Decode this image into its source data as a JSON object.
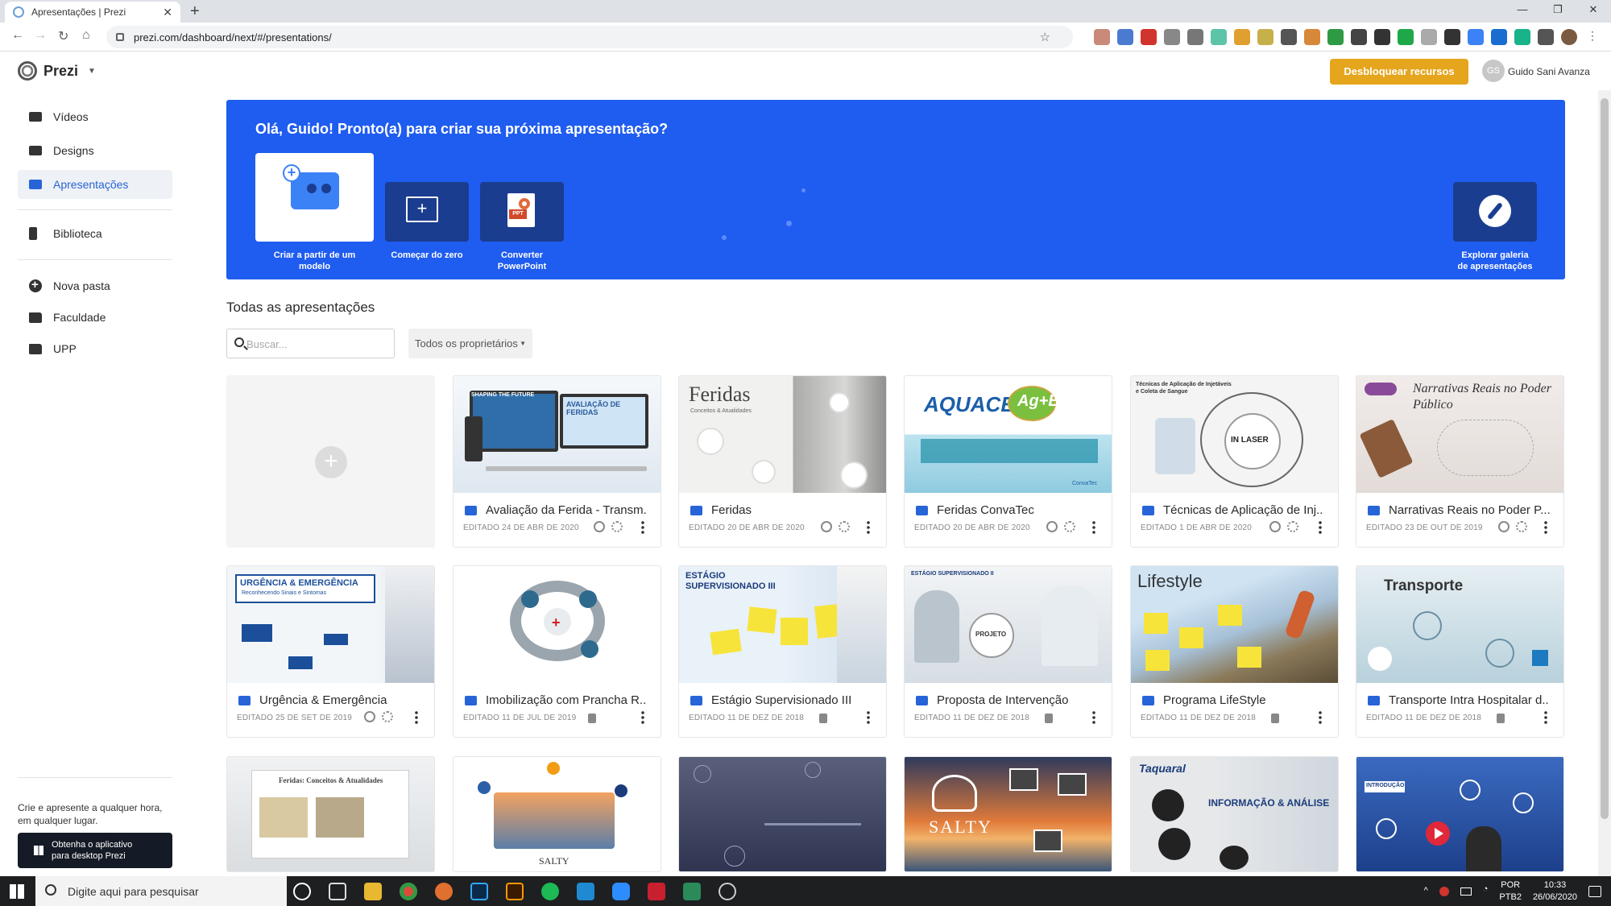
{
  "browser": {
    "tab_title": "Apresentações | Prezi",
    "url": "prezi.com/dashboard/next/#/presentations/"
  },
  "header": {
    "logo_text": "Prezi",
    "unlock_button": "Desbloquear recursos",
    "avatar_initials": "GS",
    "user_name": "Guido Sani Avanza"
  },
  "sidebar": {
    "items": [
      {
        "label": "Vídeos"
      },
      {
        "label": "Designs"
      },
      {
        "label": "Apresentações"
      },
      {
        "label": "Biblioteca"
      },
      {
        "label": "Nova pasta"
      },
      {
        "label": "Faculdade"
      },
      {
        "label": "UPP"
      }
    ],
    "promo_text": "Crie e apresente a qualquer hora, em qualquer lugar.",
    "get_app_line1": "Obtenha o aplicativo",
    "get_app_line2": "para desktop Prezi"
  },
  "hero": {
    "greeting": "Olá, Guido! Pronto(a) para criar sua próxima apresentação?",
    "card_template_l1": "Criar a partir de um",
    "card_template_l2": "modelo",
    "card_blank": "Começar do zero",
    "card_ppt_l1": "Converter",
    "card_ppt_l2": "PowerPoint",
    "card_gallery_l1": "Explorar galeria",
    "card_gallery_l2": "de apresentações"
  },
  "section": {
    "title": "Todas as apresentações",
    "search_placeholder": "Buscar...",
    "owners_filter": "Todos os proprietários"
  },
  "presentations": [
    {
      "title": "Avaliação da Ferida - Transm...",
      "edited": "EDITADO 24 DE ABR DE 2020",
      "status": "public"
    },
    {
      "title": "Feridas",
      "edited": "EDITADO 20 DE ABR DE 2020",
      "status": "public"
    },
    {
      "title": "Feridas ConvaTec",
      "edited": "EDITADO 20 DE ABR DE 2020",
      "status": "public"
    },
    {
      "title": "Técnicas de Aplicação de Inj...",
      "edited": "EDITADO 1 DE ABR DE 2020",
      "status": "public"
    },
    {
      "title": "Narrativas Reais no Poder P...",
      "edited": "EDITADO 23 DE OUT DE 2019",
      "status": "public"
    },
    {
      "title": "Urgência & Emergência",
      "edited": "EDITADO 25 DE SET DE 2019",
      "status": "public"
    },
    {
      "title": "Imobilização com Prancha R...",
      "edited": "EDITADO 11 DE JUL DE 2019",
      "status": "private"
    },
    {
      "title": "Estágio Supervisionado III",
      "edited": "EDITADO 11 DE DEZ DE 2018",
      "status": "private"
    },
    {
      "title": "Proposta de Intervenção",
      "edited": "EDITADO 11 DE DEZ DE 2018",
      "status": "private"
    },
    {
      "title": "Programa LifeStyle",
      "edited": "EDITADO 11 DE DEZ DE 2018",
      "status": "private"
    },
    {
      "title": "Transporte Intra Hospitalar d...",
      "edited": "EDITADO 11 DE DEZ DE 2018",
      "status": "private"
    }
  ],
  "thumb_texts": {
    "feridas_title": "Feridas",
    "feridas_sub": "Conceitos & Atualidades",
    "aquacel": "AQUACEL",
    "aquacel_ag": "Ag+Extra",
    "convatec": "ConvaTec",
    "tecnicas": "Técnicas de Aplicação de Injetáveis e Coleta de Sangue",
    "inlaser": "IN LASER",
    "narrativas": "Narrativas Reais no Poder Público",
    "urgencia": "URGÊNCIA & EMERGÊNCIA",
    "urgencia_sub": "Reconhecendo Sinais e Sintomas",
    "estagio3": "ESTÁGIO SUPERVISIONADO III",
    "estagio2": "ESTÁGIO SUPERVISIONADO II",
    "projeto": "PROJETO",
    "lifestyle": "Lifestyle",
    "transporte": "Transporte",
    "avaliacao": "AVALIAÇÃO DE FERIDAS",
    "shaping": "SHAPING THE FUTURE",
    "feridas_conceitos": "Feridas: Conceitos & Atualidades",
    "salty": "SALTY",
    "taquaral": "Taquaral",
    "informacao": "INFORMAÇÃO & ANÁLISE",
    "introducao": "INTRODUÇÃO"
  },
  "taskbar": {
    "search_placeholder": "Digite aqui para pesquisar",
    "lang_top": "POR",
    "lang_bottom": "PTB2",
    "time": "10:33",
    "date": "26/06/2020"
  },
  "colors": {
    "hero_blue": "#1f5cf0",
    "accent_blue": "#2764d7",
    "unlock_orange": "#e5a51c"
  }
}
